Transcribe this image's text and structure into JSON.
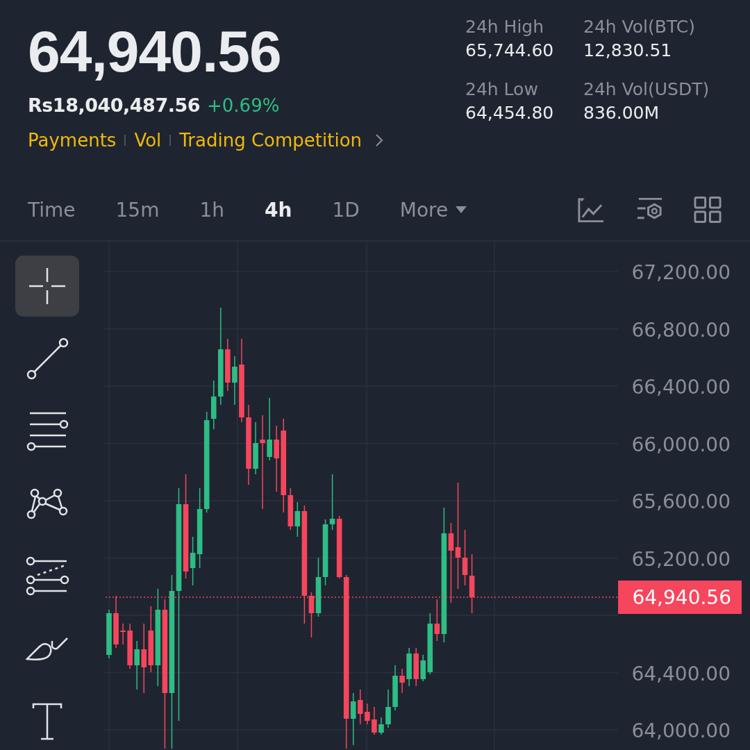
{
  "ticker": {
    "last_price": "64,940.56",
    "local_price": "Rs18,040,487.56",
    "change": "+0.69%"
  },
  "links": [
    {
      "label": "Payments"
    },
    {
      "label": "Vol"
    },
    {
      "label": "Trading Competition"
    }
  ],
  "stats": [
    {
      "label": "24h High",
      "value": "65,744.60"
    },
    {
      "label": "24h Vol(BTC)",
      "value": "12,830.51"
    },
    {
      "label": "24h Low",
      "value": "64,454.80"
    },
    {
      "label": "24h Vol(USDT)",
      "value": "836.00M"
    }
  ],
  "intervals": [
    {
      "label": "Time",
      "kind": "interval",
      "selected": false
    },
    {
      "label": "15m",
      "kind": "interval",
      "selected": false
    },
    {
      "label": "1h",
      "kind": "interval",
      "selected": false
    },
    {
      "label": "4h",
      "kind": "interval",
      "selected": true
    },
    {
      "label": "1D",
      "kind": "interval",
      "selected": false
    },
    {
      "label": "More",
      "kind": "dropdown",
      "selected": false
    }
  ],
  "chart_tools": [
    {
      "kind": "indicator"
    },
    {
      "kind": "settings"
    },
    {
      "kind": "layout"
    }
  ],
  "drawing_tools": [
    {
      "kind": "crosshair",
      "selected": true
    },
    {
      "kind": "trend-line",
      "selected": false
    },
    {
      "kind": "horizontal-lines",
      "selected": false
    },
    {
      "kind": "pattern",
      "selected": false
    },
    {
      "kind": "channel",
      "selected": false
    },
    {
      "kind": "brush",
      "selected": false
    },
    {
      "kind": "text",
      "selected": false
    }
  ],
  "price_axis": {
    "labels_above_tag": [
      "67,200.00",
      "66,800.00",
      "66,400.00",
      "66,000.00",
      "65,600.00",
      "65,200.00"
    ],
    "labels_below_tag": [
      "64,400.00",
      "64,000.00"
    ]
  },
  "last_price_tag": {
    "label": "64,940.56"
  }
}
